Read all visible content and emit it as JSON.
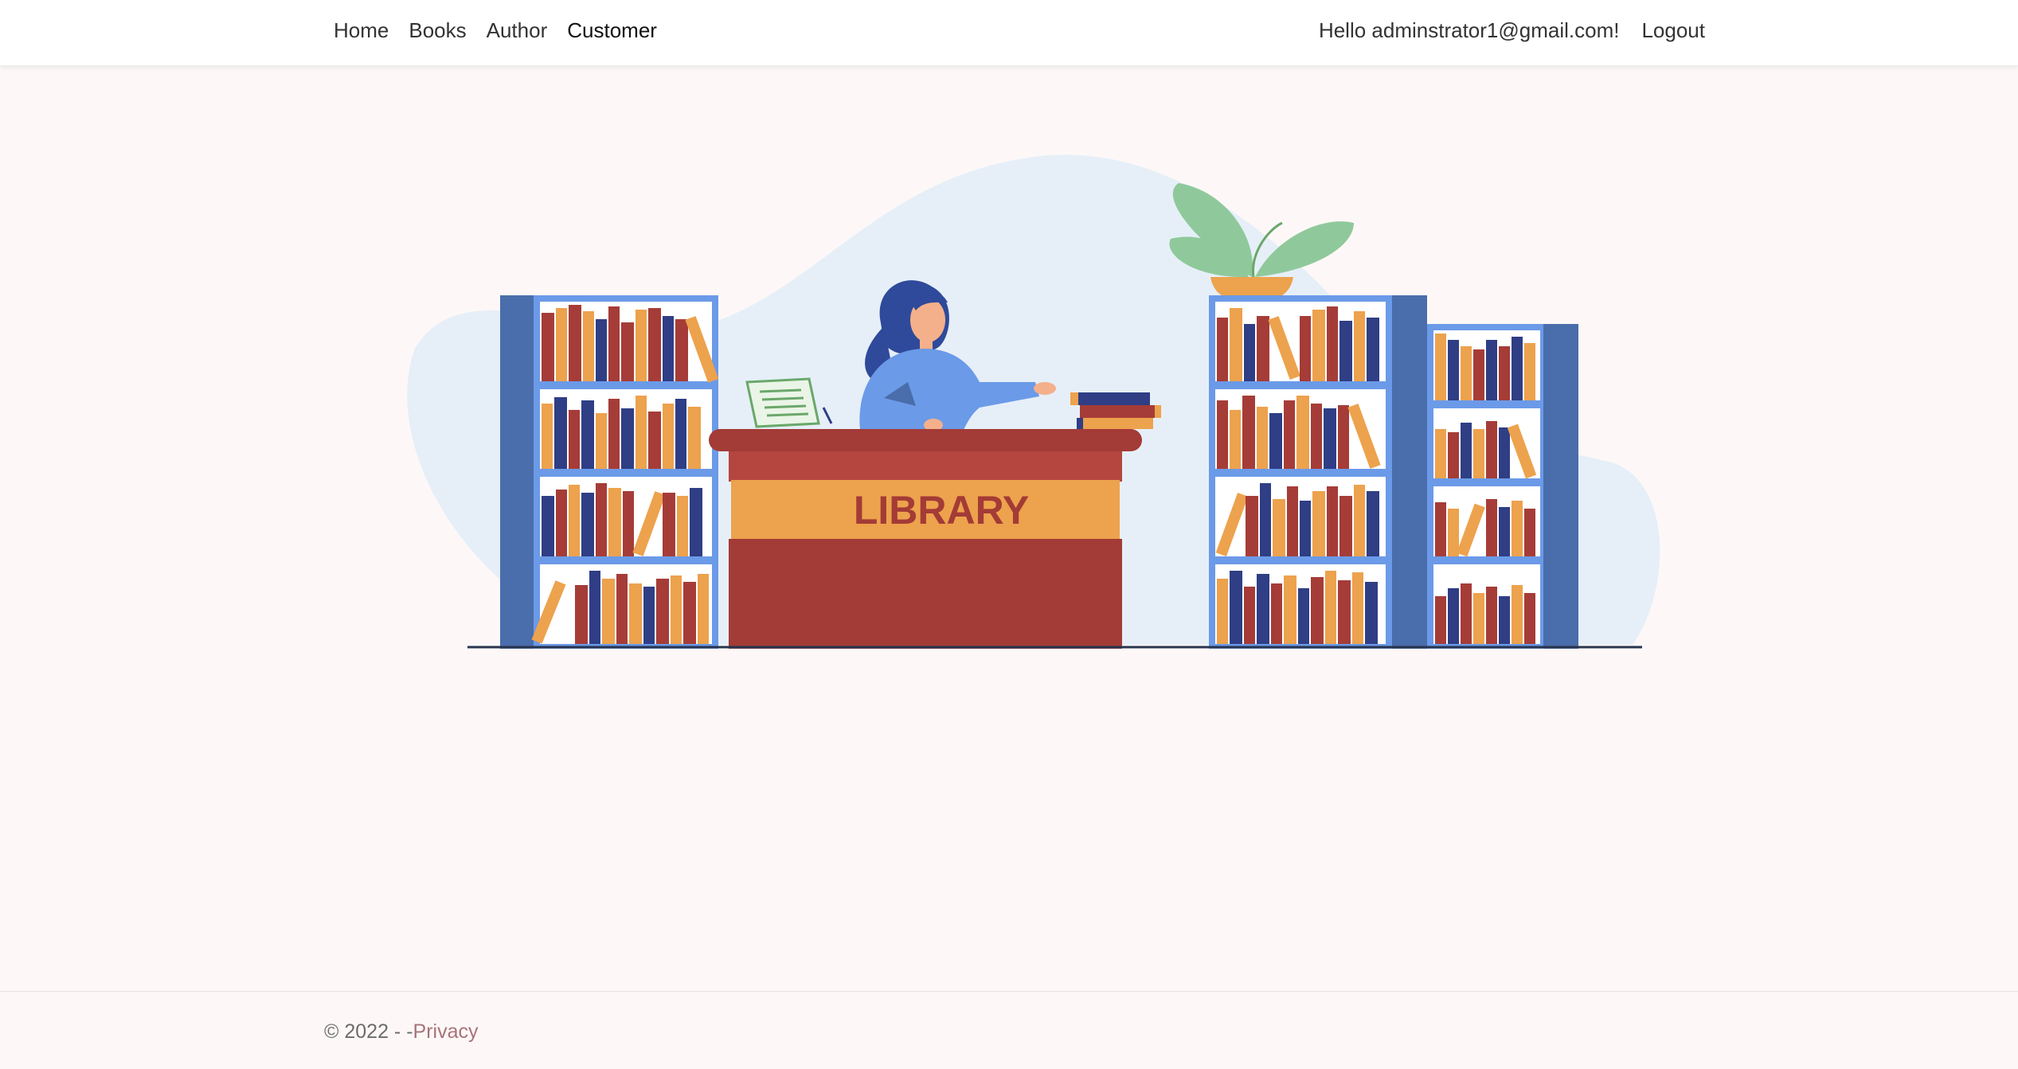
{
  "nav": {
    "links": [
      {
        "label": "Home"
      },
      {
        "label": "Books"
      },
      {
        "label": "Author"
      },
      {
        "label": "Customer"
      }
    ],
    "greeting": "Hello adminstrator1@gmail.com!",
    "logout_label": "Logout"
  },
  "hero": {
    "desk_sign": "LIBRARY"
  },
  "footer": {
    "copyright": "© 2022 - -",
    "privacy_label": "Privacy"
  },
  "colors": {
    "background": "#fdf8f7",
    "shelf_blue": "#4a6dab",
    "book_red": "#a63c37",
    "book_orange": "#eda24d",
    "book_navy": "#2f3e85",
    "desk_red": "#a33b36",
    "link_privacy": "#a8737a"
  }
}
